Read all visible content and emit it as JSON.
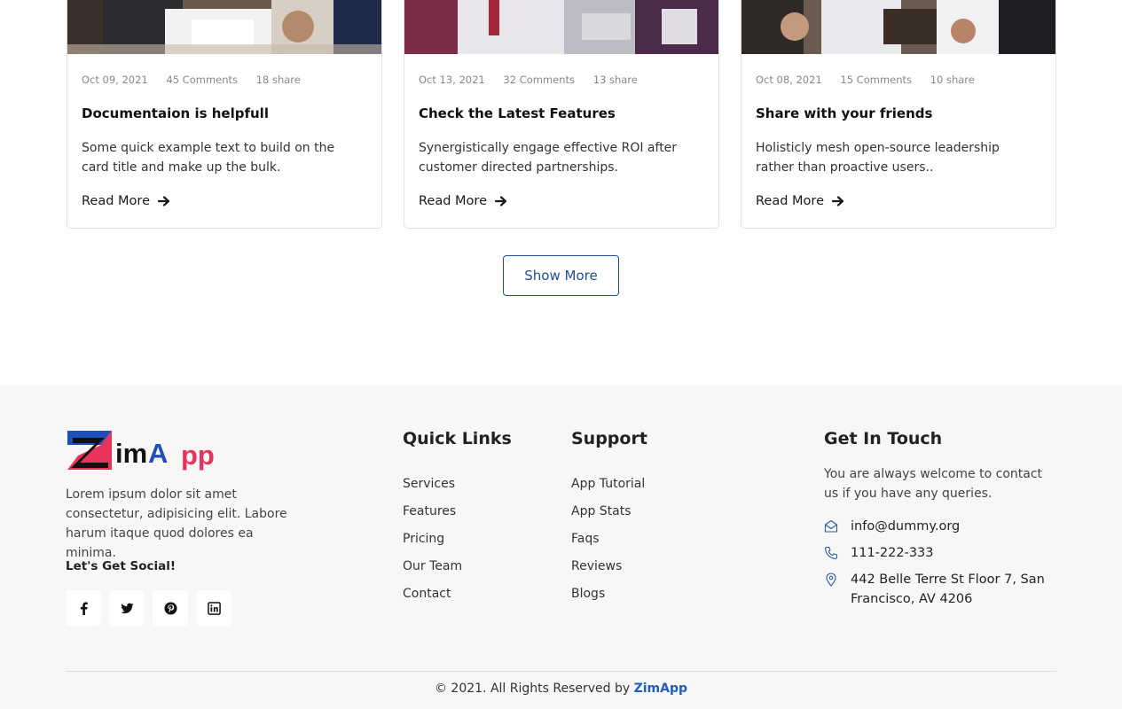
{
  "cards": [
    {
      "date": "Oct 09, 2021",
      "comments": "45 Comments",
      "shares": "18 share",
      "title": "Documentaion is helpfull",
      "text": "Some quick example text to build on the card title and make up the bulk.",
      "read_more": "Read More"
    },
    {
      "date": "Oct 13, 2021",
      "comments": "32 Comments",
      "shares": "13 share",
      "title": "Check the Latest Features",
      "text": "Synergistically engage effective ROI after customer directed partnerships.",
      "read_more": "Read More"
    },
    {
      "date": "Oct 08, 2021",
      "comments": "15 Comments",
      "shares": "10 share",
      "title": "Share with your friends",
      "text": "Holisticly mesh open-source leadership rather than proactive users..",
      "read_more": "Read More"
    }
  ],
  "show_more": "Show More",
  "footer": {
    "logo": {
      "part1": "Zim",
      "part2": "A",
      "part3": "pp",
      "accent_colors": [
        "#1f4fb8",
        "#e8335a"
      ]
    },
    "about": "Lorem ipsum dolor sit amet consectetur, adipisicing elit. Labore harum itaque quod dolores ea minima.",
    "social_title": "Let's Get Social!",
    "social_icons": [
      "facebook-icon",
      "twitter-icon",
      "pinterest-icon",
      "linkedin-icon"
    ],
    "quick_links": {
      "title": "Quick Links",
      "items": [
        "Services",
        "Features",
        "Pricing",
        "Our Team",
        "Contact"
      ]
    },
    "support": {
      "title": "Support",
      "items": [
        "App Tutorial",
        "App Stats",
        "Faqs",
        "Reviews",
        "Blogs"
      ]
    },
    "contact": {
      "title": "Get In Touch",
      "text": "You are always welcome to contact us if you have any queries.",
      "email": "info@dummy.org",
      "phone": "111-222-333",
      "address": "442 Belle Terre St Floor 7, San Francisco, AV 4206"
    },
    "copyright_text": "© 2021. All Rights Reserved by ",
    "copyright_brand": "ZimApp",
    "brand_color": "#1f5fb8"
  }
}
